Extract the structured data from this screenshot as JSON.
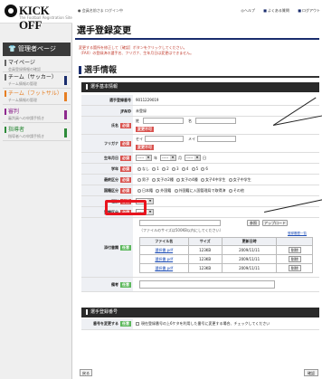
{
  "brand": {
    "name": "KICK OFF",
    "tagline": "The Football Registration Site"
  },
  "header": {
    "breadcrumb": "● 会員名前さま ログイン中",
    "links": [
      "◎ヘルプ",
      "よくある質問",
      "ログアウト"
    ]
  },
  "sidebar": {
    "title": "管理者ページ",
    "items": [
      {
        "label": "マイページ",
        "sub": "会員登録情報の確認",
        "flag": ""
      },
      {
        "label": "チーム（サッカー）",
        "sub": "チーム情報の管理",
        "flag": "#1a2d6d"
      },
      {
        "label": "チーム（フットサル）",
        "sub": "チーム情報の管理",
        "flag": "#e67e22"
      },
      {
        "label": "審判",
        "sub": "審判員への申請手続き",
        "flag": "#8e2a8e"
      },
      {
        "label": "指導者",
        "sub": "指導者への申請手続き",
        "flag": "#2e8b3a"
      }
    ]
  },
  "page": {
    "title": "選手登録変更",
    "notice": [
      "変更する箇所を修正して［確認］ボタンをクリックしてください。",
      "（FAX）の登録済の選手名、フリガナ、生年月日は変更はできません。"
    ]
  },
  "panel": {
    "heading": "選手情報",
    "basic_section": "選手基本情報",
    "other_section": "選手登録番号"
  },
  "badges": {
    "required": "必須",
    "optional": "任意"
  },
  "form": {
    "player_no": {
      "label": "選手登録番号",
      "value": "9011229019"
    },
    "jfa_id": {
      "label": "JFAID",
      "value": "未登録"
    },
    "name": {
      "label": "氏名",
      "sei": "姓",
      "mei": "名",
      "note": "変更不可"
    },
    "kana": {
      "label": "フリガナ",
      "sei": "セイ",
      "mei": "メイ",
      "note": "変更不可"
    },
    "birth": {
      "label": "生年月日",
      "year_suffix": "年",
      "month_suffix": "月",
      "day_suffix": "日",
      "placeholder": "-----"
    },
    "grade": {
      "label": "学年",
      "options": [
        "なし",
        "1",
        "2",
        "3",
        "4",
        "5",
        "6"
      ]
    },
    "gender": {
      "label": "最終区分",
      "options": [
        "男子",
        "女子の2種",
        "女子の4種",
        "女子4中学生",
        "女子中学生"
      ]
    },
    "nationality": {
      "label": "国籍区分",
      "options": [
        "日本籍",
        "外国籍",
        "外国籍に入国管理局で取得済",
        "その他"
      ]
    },
    "position": {
      "label": "種別",
      "value": "-----"
    },
    "reg_type": {
      "label": "登録区分",
      "value": "-----"
    },
    "attach": {
      "label": "添付書類",
      "button_ref": "参照",
      "button_upload": "アップロード",
      "hint": "（ファイルのサイズは500KB以内にしてください）",
      "history_link": "登録履歴一覧",
      "columns": [
        "ファイル名",
        "サイズ",
        "更新日時",
        ""
      ],
      "rows": [
        {
          "file": "選択書.pdf",
          "size": "123KB",
          "date": "2009/11/11",
          "action": "削除"
        },
        {
          "file": "選択書.pdf",
          "size": "123KB",
          "date": "2009/11/11",
          "action": "削除"
        },
        {
          "file": "選択書.pdf",
          "size": "123KB",
          "date": "2009/11/11",
          "action": "削除"
        }
      ]
    },
    "remarks": {
      "label": "備考"
    },
    "change_no": {
      "label": "番号を変更する",
      "checkbox_text": "現在登録番号の上6ケタを利用した番号に変更する場合、チェックしてください"
    }
  },
  "footer": {
    "back": "戻る",
    "confirm": "確認"
  }
}
